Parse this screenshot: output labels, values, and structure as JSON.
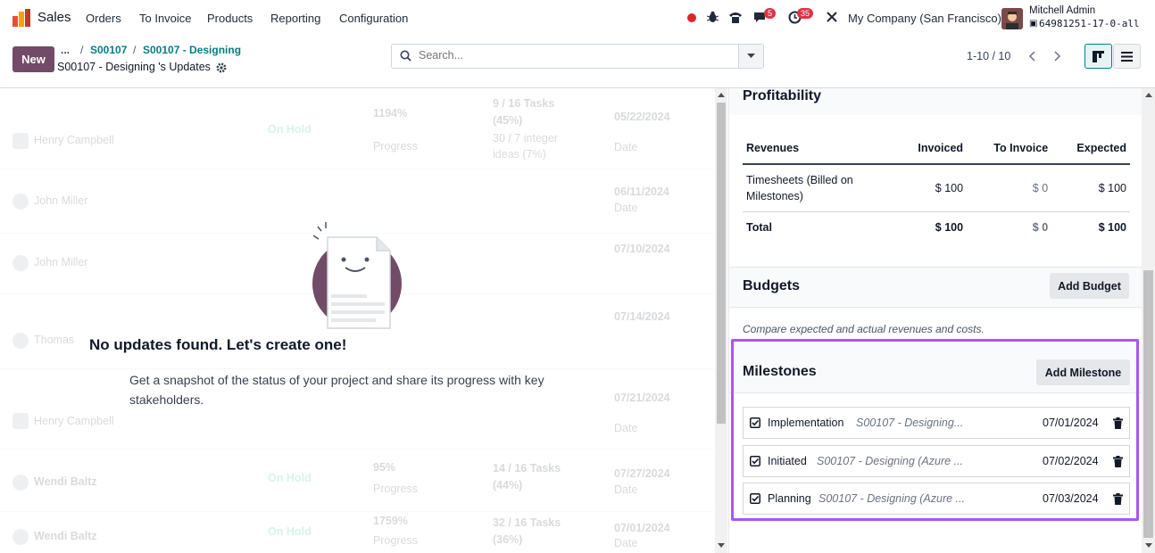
{
  "navbar": {
    "app_name": "Sales",
    "menu": [
      "Orders",
      "To Invoice",
      "Products",
      "Reporting",
      "Configuration"
    ],
    "badges": {
      "messages": "5",
      "activities": "35"
    },
    "company": "My Company (San Francisco)",
    "user_name": "Mitchell Admin",
    "database": "64981251-17-0-all"
  },
  "control": {
    "new_label": "New",
    "breadcrumb_more": "...",
    "breadcrumb": [
      "S00107",
      "S00107 - Designing"
    ],
    "record_title": "S00107 - Designing 's Updates",
    "search_placeholder": "Search...",
    "pager": "1-10 / 10"
  },
  "ghost_rows": [
    {
      "name": "Henry Campbell",
      "status": "On Hold",
      "percent": "1194%",
      "progress": "Progress",
      "tasks": "9 / 16 Tasks",
      "tasks_pct": "(45%)",
      "extra": "30 / 7 integer",
      "extra2": "ideas (7%)",
      "date": "05/22/2024",
      "date_label": "Date"
    },
    {
      "name": "John Miller",
      "status": "",
      "percent": "",
      "progress": "",
      "tasks": "",
      "tasks_pct": "",
      "extra": "",
      "extra2": "",
      "date": "06/11/2024",
      "date_label": "Date"
    },
    {
      "name": "John Miller",
      "status": "",
      "percent": "",
      "progress": "",
      "tasks": "",
      "tasks_pct": "",
      "extra": "",
      "extra2": "",
      "date": "07/10/2024",
      "date_label": ""
    },
    {
      "name": "Thomas",
      "status": "",
      "percent": "",
      "progress": "",
      "tasks": "",
      "tasks_pct": "",
      "extra": "",
      "extra2": "",
      "date": "07/14/2024",
      "date_label": ""
    },
    {
      "name": "Henry Campbell",
      "status": "",
      "percent": "",
      "progress": "",
      "tasks": "",
      "tasks_pct": "",
      "extra": "",
      "extra2": "",
      "date": "07/21/2024",
      "date_label": "Date"
    },
    {
      "name": "Wendi Baltz",
      "status": "On Hold",
      "percent": "95%",
      "progress": "Progress",
      "tasks": "14 / 16 Tasks",
      "tasks_pct": "(44%)",
      "extra": "",
      "extra2": "",
      "date": "07/27/2024",
      "date_label": "Date"
    },
    {
      "name": "Wendi Baltz",
      "status": "On Hold",
      "percent": "1759%",
      "progress": "Progress",
      "tasks": "32 / 16 Tasks",
      "tasks_pct": "(36%)",
      "extra": "",
      "extra2": "",
      "date": "07/01/2024",
      "date_label": "Date"
    }
  ],
  "empty_state": {
    "title": "No updates found. Let's create one!",
    "text": "Get a snapshot of the status of your project and share its progress with key stakeholders."
  },
  "profitability": {
    "title": "Profitability",
    "headers": [
      "Revenues",
      "Invoiced",
      "To Invoice",
      "Expected"
    ],
    "rows": [
      {
        "label": "Timesheets (Billed on Milestones)",
        "invoiced": "$ 100",
        "to_invoice": "$ 0",
        "expected": "$ 100"
      }
    ],
    "total": {
      "label": "Total",
      "invoiced": "$ 100",
      "to_invoice": "$ 0",
      "expected": "$ 100"
    }
  },
  "budgets": {
    "title": "Budgets",
    "button": "Add Budget",
    "description": "Compare expected and actual revenues and costs."
  },
  "milestones": {
    "title": "Milestones",
    "button": "Add Milestone",
    "items": [
      {
        "name": "Implementation",
        "order": "S00107 - Designing...",
        "date": "07/01/2024"
      },
      {
        "name": "Initiated",
        "order": "S00107 - Designing (Azure ...",
        "date": "07/02/2024"
      },
      {
        "name": "Planning",
        "order": "S00107 - Designing (Azure ...",
        "date": "07/03/2024"
      }
    ]
  },
  "colors": {
    "brand": "#714b67",
    "link": "#017e84",
    "highlight": "#a855f7"
  }
}
